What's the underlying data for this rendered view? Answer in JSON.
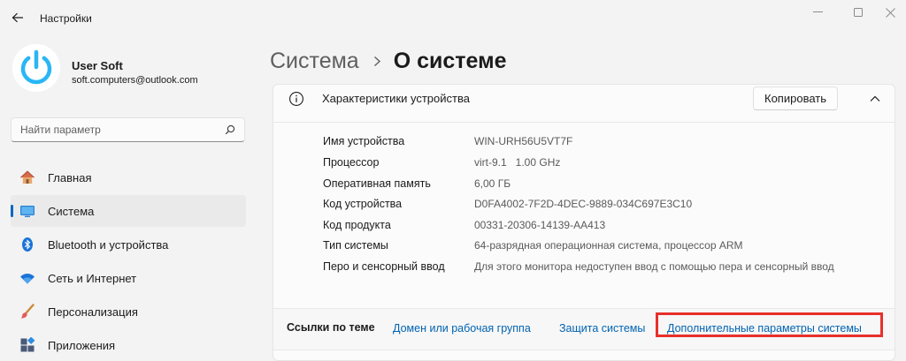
{
  "app": {
    "title": "Настройки"
  },
  "profile": {
    "name": "User Soft",
    "email": "soft.computers@outlook.com"
  },
  "search": {
    "placeholder": "Найти параметр"
  },
  "nav": {
    "items": [
      {
        "label": "Главная",
        "icon": "home-icon",
        "active": false
      },
      {
        "label": "Система",
        "icon": "monitor-icon",
        "active": true
      },
      {
        "label": "Bluetooth и устройства",
        "icon": "bluetooth-icon",
        "active": false
      },
      {
        "label": "Сеть и Интернет",
        "icon": "wifi-icon",
        "active": false
      },
      {
        "label": "Персонализация",
        "icon": "brush-icon",
        "active": false
      },
      {
        "label": "Приложения",
        "icon": "apps-icon",
        "active": false
      }
    ]
  },
  "breadcrumb": {
    "parent": "Система",
    "current": "О системе"
  },
  "device_specs": {
    "title": "Характеристики устройства",
    "copy_label": "Копировать",
    "rows": [
      {
        "label": "Имя устройства",
        "value": "WIN-URH56U5VT7F"
      },
      {
        "label": "Процессор",
        "value": "virt-9.1   1.00 GHz"
      },
      {
        "label": "Оперативная память",
        "value": "6,00 ГБ"
      },
      {
        "label": "Код устройства",
        "value": "D0FA4002-7F2D-4DEC-9889-034C697E3C10"
      },
      {
        "label": "Код продукта",
        "value": "00331-20306-14139-AA413"
      },
      {
        "label": "Тип системы",
        "value": "64-разрядная операционная система, процессор ARM"
      },
      {
        "label": "Перо и сенсорный ввод",
        "value": "Для этого монитора недоступен ввод с помощью пера и сенсорный ввод"
      }
    ]
  },
  "related": {
    "label": "Ссылки по теме",
    "links": [
      "Домен или рабочая группа",
      "Защита системы",
      "Дополнительные параметры системы"
    ]
  },
  "colors": {
    "accent": "#0067c0",
    "link": "#0063b1",
    "highlight": "#e8302a"
  }
}
